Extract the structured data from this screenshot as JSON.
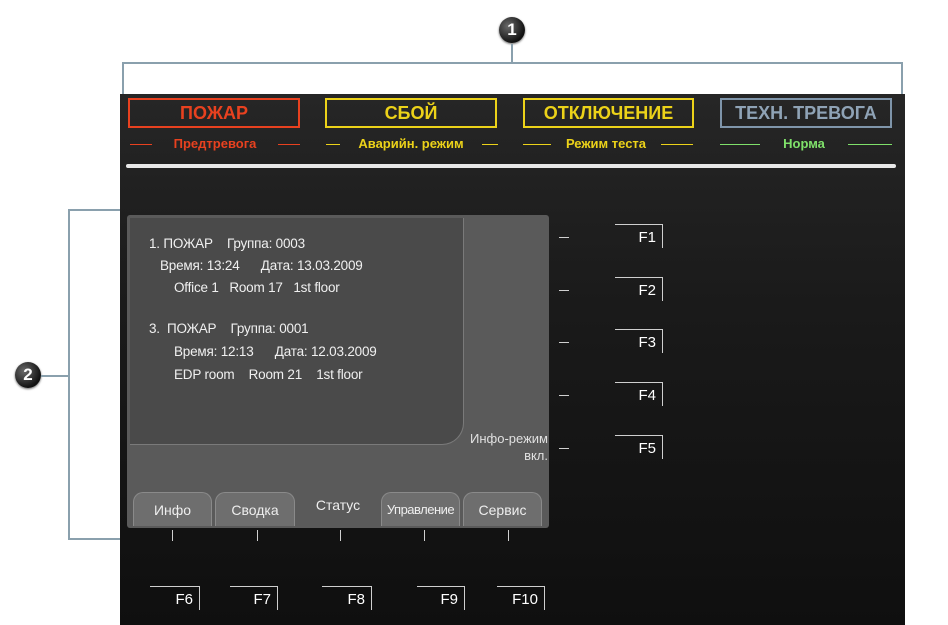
{
  "callouts": [
    "1",
    "2"
  ],
  "status_bar": [
    {
      "label": "ПОЖАР",
      "sub": "Предтревога",
      "color": "#e8411f",
      "sub_color": "#e8411f"
    },
    {
      "label": "СБОЙ",
      "sub": "Аварийн. режим",
      "color": "#ecd219",
      "sub_color": "#ecd219"
    },
    {
      "label": "ОТКЛЮЧЕНИЕ",
      "sub": "Режим теста",
      "color": "#ecd219",
      "sub_color": "#ecd219"
    },
    {
      "label": "ТЕХН. ТРЕВОГА",
      "sub": "Норма",
      "color": "#7f95aa",
      "sub_color": "#7fe06a"
    }
  ],
  "messages": [
    {
      "line1": "1. ПОЖАР    Группа: 0003",
      "line2": "Время: 13:24      Дата: 13.03.2009",
      "line3": "Office 1   Room 17   1st floor"
    },
    {
      "line1": "3.  ПОЖАР    Группа: 0001",
      "line2": "Время: 12:13      Дата: 12.03.2009",
      "line3": "EDP room    Room 21    1st floor"
    }
  ],
  "info_mode": {
    "line1": "Инфо-режим",
    "line2": "вкл."
  },
  "tabs": [
    "Инфо",
    "Сводка",
    "Статус",
    "Управление",
    "Сервис"
  ],
  "active_tab": "Статус",
  "side_keys": [
    "F1",
    "F2",
    "F3",
    "F4",
    "F5"
  ],
  "bottom_keys": [
    "F6",
    "F7",
    "F8",
    "F9",
    "F10"
  ]
}
